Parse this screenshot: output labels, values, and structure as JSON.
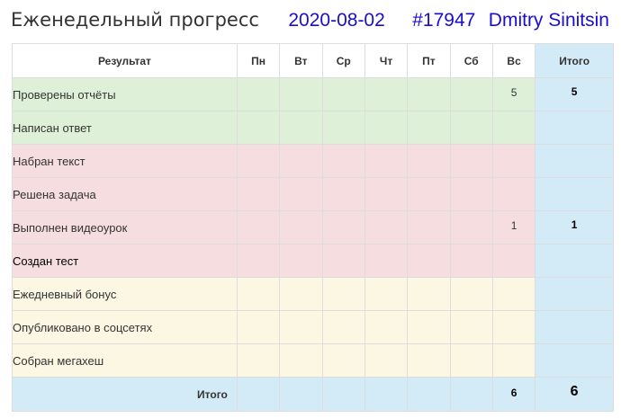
{
  "header": {
    "title": "Еженедельный прогресс",
    "date": "2020-08-02",
    "id": "#17947",
    "user": "Dmitry Sinitsin"
  },
  "colors": {
    "meta_text": "#1a0dcc",
    "green_row": "#dff0d8",
    "red_row": "#f6dde0",
    "yellow_row": "#fcf7e3",
    "total_col": "#d3ebf6"
  },
  "table": {
    "headers": {
      "result": "Результат",
      "days": [
        "Пн",
        "Вт",
        "Ср",
        "Чт",
        "Пт",
        "Сб",
        "Вс"
      ],
      "total": "Итого"
    },
    "rows": [
      {
        "label": "Проверены отчёты",
        "days": [
          "",
          "",
          "",
          "",
          "",
          "",
          "5"
        ],
        "total": "5"
      },
      {
        "label": "Написан ответ",
        "days": [
          "",
          "",
          "",
          "",
          "",
          "",
          ""
        ],
        "total": ""
      },
      {
        "label": "Набран текст",
        "days": [
          "",
          "",
          "",
          "",
          "",
          "",
          ""
        ],
        "total": ""
      },
      {
        "label": "Решена задача",
        "days": [
          "",
          "",
          "",
          "",
          "",
          "",
          ""
        ],
        "total": ""
      },
      {
        "label": "Выполнен видеоурок",
        "days": [
          "",
          "",
          "",
          "",
          "",
          "",
          "1"
        ],
        "total": "1"
      },
      {
        "label": "Создан тест",
        "days": [
          "",
          "",
          "",
          "",
          "",
          "",
          ""
        ],
        "total": ""
      },
      {
        "label": "Ежедневный бонус",
        "days": [
          "",
          "",
          "",
          "",
          "",
          "",
          ""
        ],
        "total": ""
      },
      {
        "label": "Опубликовано в соцсетях",
        "days": [
          "",
          "",
          "",
          "",
          "",
          "",
          ""
        ],
        "total": ""
      },
      {
        "label": "Собран мегахеш",
        "days": [
          "",
          "",
          "",
          "",
          "",
          "",
          ""
        ],
        "total": ""
      }
    ],
    "footer": {
      "label": "Итого",
      "days": [
        "",
        "",
        "",
        "",
        "",
        "",
        "6"
      ],
      "total": "6"
    }
  }
}
